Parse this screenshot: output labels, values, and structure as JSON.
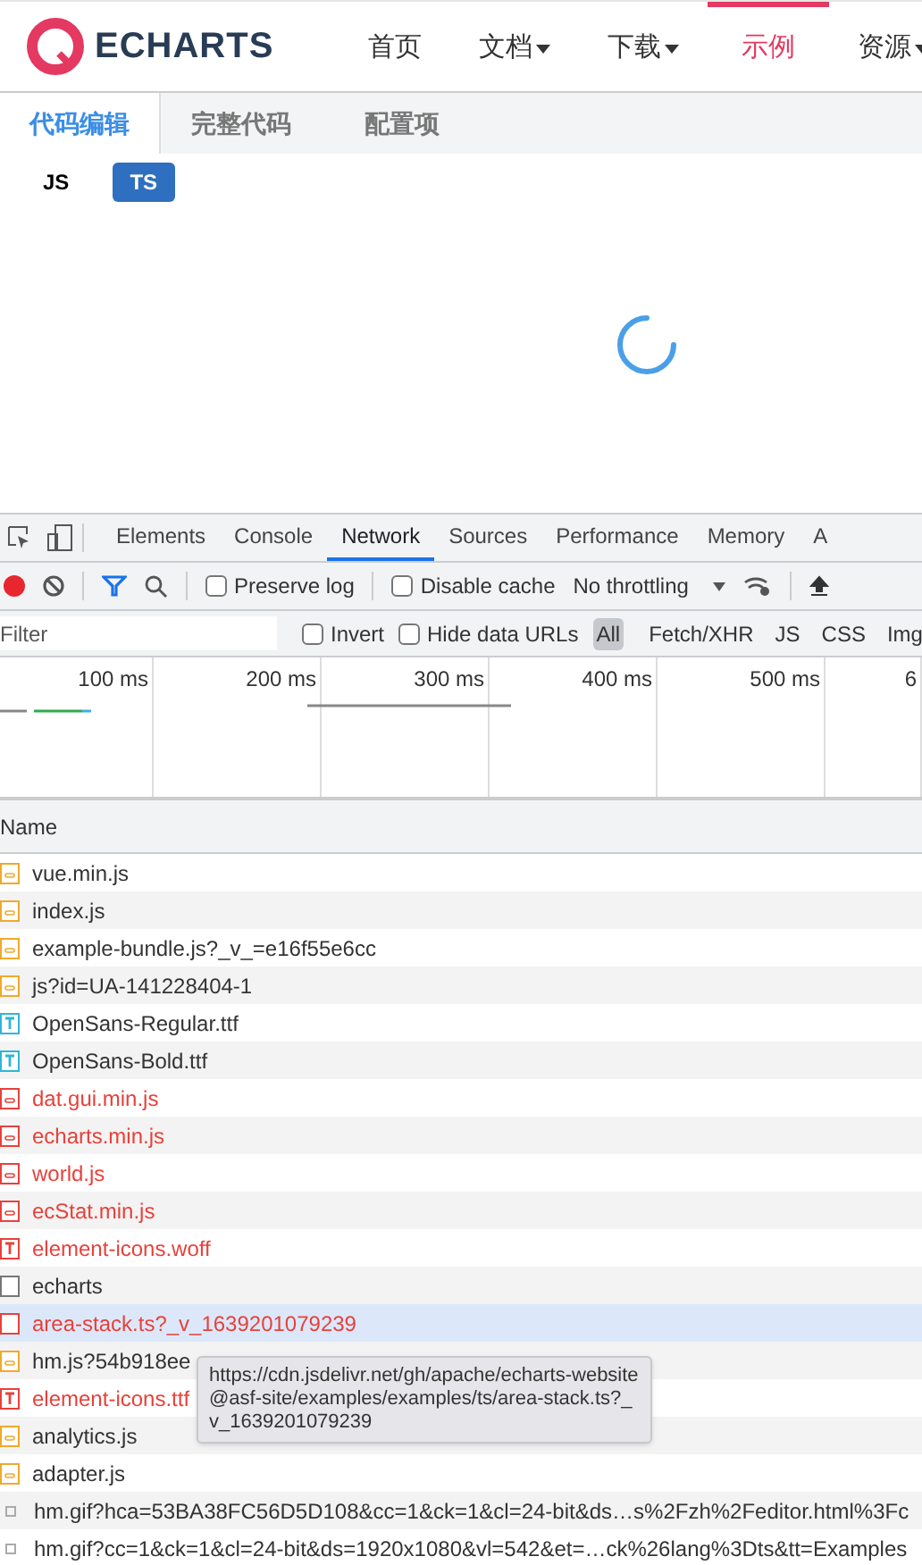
{
  "site_nav": {
    "logo": "ECHARTS",
    "items": [
      {
        "label": "首页",
        "dropdown": false,
        "selected": false
      },
      {
        "label": "文档",
        "dropdown": true,
        "selected": false
      },
      {
        "label": "下载",
        "dropdown": true,
        "selected": false
      },
      {
        "label": "示例",
        "dropdown": false,
        "selected": true
      },
      {
        "label": "资源",
        "dropdown": true,
        "selected": false
      }
    ]
  },
  "editor_tabs": [
    {
      "label": "代码编辑",
      "selected": true
    },
    {
      "label": "完整代码",
      "selected": false
    },
    {
      "label": "配置项",
      "selected": false
    }
  ],
  "lang_toggle": [
    {
      "label": "JS",
      "selected": false
    },
    {
      "label": "TS",
      "selected": true
    }
  ],
  "devtools": {
    "tabs": [
      {
        "label": "Elements",
        "selected": false
      },
      {
        "label": "Console",
        "selected": false
      },
      {
        "label": "Network",
        "selected": true
      },
      {
        "label": "Sources",
        "selected": false
      },
      {
        "label": "Performance",
        "selected": false
      },
      {
        "label": "Memory",
        "selected": false
      },
      {
        "label": "A",
        "selected": false
      }
    ],
    "toolbar": {
      "recording": true,
      "preserve_log": {
        "label": "Preserve log",
        "checked": false
      },
      "disable_cache": {
        "label": "Disable cache",
        "checked": false
      },
      "throttling": "No throttling"
    },
    "filter": {
      "placeholder": "Filter",
      "invert": {
        "label": "Invert",
        "checked": false
      },
      "hide_data_urls": {
        "label": "Hide data URLs",
        "checked": false
      },
      "types": [
        {
          "label": "All",
          "selected": true
        },
        {
          "label": "Fetch/XHR",
          "selected": false
        },
        {
          "label": "JS",
          "selected": false
        },
        {
          "label": "CSS",
          "selected": false
        },
        {
          "label": "Img",
          "selected": false
        }
      ]
    },
    "timeline_ticks": [
      "100 ms",
      "200 ms",
      "300 ms",
      "400 ms",
      "500 ms",
      "6"
    ],
    "column": "Name",
    "requests": [
      {
        "name": "vue.min.js",
        "kind": "script",
        "error": false,
        "selected": false
      },
      {
        "name": "index.js",
        "kind": "script",
        "error": false,
        "selected": false
      },
      {
        "name": "example-bundle.js?_v_=e16f55e6cc",
        "kind": "script",
        "error": false,
        "selected": false
      },
      {
        "name": "js?id=UA-141228404-1",
        "kind": "script",
        "error": false,
        "selected": false
      },
      {
        "name": "OpenSans-Regular.ttf",
        "kind": "font",
        "error": false,
        "selected": false
      },
      {
        "name": "OpenSans-Bold.ttf",
        "kind": "font",
        "error": false,
        "selected": false
      },
      {
        "name": "dat.gui.min.js",
        "kind": "script",
        "error": true,
        "selected": false
      },
      {
        "name": "echarts.min.js",
        "kind": "script",
        "error": true,
        "selected": false
      },
      {
        "name": "world.js",
        "kind": "script",
        "error": true,
        "selected": false
      },
      {
        "name": "ecStat.min.js",
        "kind": "script",
        "error": true,
        "selected": false
      },
      {
        "name": "element-icons.woff",
        "kind": "font",
        "error": true,
        "selected": false
      },
      {
        "name": "echarts",
        "kind": "document",
        "error": false,
        "selected": false
      },
      {
        "name": "area-stack.ts?_v_1639201079239",
        "kind": "document",
        "error": true,
        "selected": true
      },
      {
        "name": "hm.js?54b918ee",
        "kind": "script",
        "error": false,
        "selected": false
      },
      {
        "name": "element-icons.ttf",
        "kind": "font",
        "error": true,
        "selected": false
      },
      {
        "name": "analytics.js",
        "kind": "script",
        "error": false,
        "selected": false
      },
      {
        "name": "adapter.js",
        "kind": "script",
        "error": false,
        "selected": false
      },
      {
        "name": "hm.gif?hca=53BA38FC56D5D108&cc=1&ck=1&cl=24-bit&ds…s%2Fzh%2Feditor.html%3Fc",
        "kind": "other",
        "error": false,
        "selected": false
      },
      {
        "name": "hm.gif?cc=1&ck=1&cl=24-bit&ds=1920x1080&vl=542&et=…ck%26lang%3Dts&tt=Examples",
        "kind": "other",
        "error": false,
        "selected": false
      }
    ],
    "tooltip": "https://cdn.jsdelivr.net/gh/apache/echarts-website@asf-site/examples/examples/ts/area-stack.ts?_v_1639201079239"
  }
}
